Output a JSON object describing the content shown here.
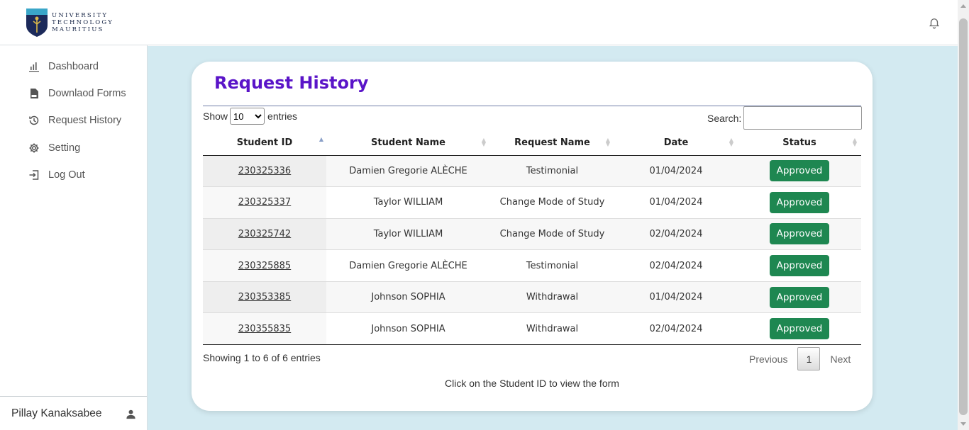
{
  "header": {
    "logo_lines": [
      "UNIVERSITY",
      "TECHNOLOGY",
      "MAURITIUS"
    ],
    "notification_icon": "bell-icon"
  },
  "sidebar": {
    "items": [
      {
        "label": "Dashboard",
        "icon": "bar-chart-icon"
      },
      {
        "label": "Downlaod Forms",
        "icon": "pdf-file-icon"
      },
      {
        "label": "Request History",
        "icon": "history-icon"
      },
      {
        "label": "Setting",
        "icon": "gear-icon"
      },
      {
        "label": "Log Out",
        "icon": "logout-icon"
      }
    ],
    "user_name": "Pillay Kanaksabee"
  },
  "main": {
    "title": "Request History",
    "show_label": "Show",
    "entries_label": "entries",
    "entries_value": "10",
    "search_label": "Search:",
    "search_value": "",
    "columns": [
      "Student ID",
      "Student Name",
      "Request Name",
      "Date",
      "Status"
    ],
    "rows": [
      {
        "id": "230325336",
        "name": "Damien Gregorie ALÈCHE",
        "request": "Testimonial",
        "date": "01/04/2024",
        "status": "Approved"
      },
      {
        "id": "230325337",
        "name": "Taylor WILLIAM",
        "request": "Change Mode of Study",
        "date": "01/04/2024",
        "status": "Approved"
      },
      {
        "id": "230325742",
        "name": "Taylor WILLIAM",
        "request": "Change Mode of Study",
        "date": "02/04/2024",
        "status": "Approved"
      },
      {
        "id": "230325885",
        "name": "Damien Gregorie ALÈCHE",
        "request": "Testimonial",
        "date": "02/04/2024",
        "status": "Approved"
      },
      {
        "id": "230353385",
        "name": "Johnson SOPHIA",
        "request": "Withdrawal",
        "date": "01/04/2024",
        "status": "Approved"
      },
      {
        "id": "230355835",
        "name": "Johnson SOPHIA",
        "request": "Withdrawal",
        "date": "02/04/2024",
        "status": "Approved"
      }
    ],
    "info": "Showing 1 to 6 of 6 entries",
    "pagination": {
      "previous": "Previous",
      "current": "1",
      "next": "Next"
    },
    "hint": "Click on the Student ID to view the form"
  },
  "colors": {
    "accent": "#5a14c8",
    "approved": "#1e8751",
    "background": "#d3eaf1"
  }
}
